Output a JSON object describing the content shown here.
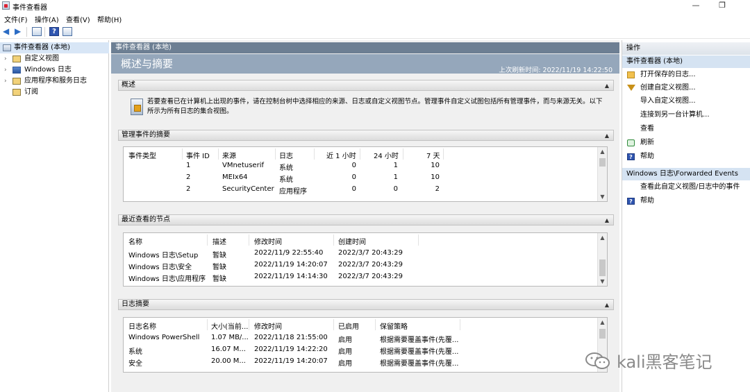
{
  "window": {
    "title": "事件查看器",
    "controls": {
      "minimize": "—",
      "restore": "❐",
      "close": "✕"
    }
  },
  "menu": [
    "文件(F)",
    "操作(A)",
    "查看(V)",
    "帮助(H)"
  ],
  "tree": {
    "root": "事件查看器 (本地)",
    "items": [
      "自定义视图",
      "Windows 日志",
      "应用程序和服务日志",
      "订阅"
    ]
  },
  "center": {
    "header": "事件查看器 (本地)",
    "banner_title": "概述与摘要",
    "last_refresh": "上次刷新时间: 2022/11/19 14:22:50",
    "overview": {
      "title": "概述",
      "text": "若要查看已在计算机上出现的事件，请在控制台树中选择相应的来源、日志或自定义视图节点。管理事件自定义试图包括所有管理事件，而与来源无关。以下所示为所有日志的集合视图。"
    },
    "admin_summary": {
      "title": "管理事件的摘要",
      "columns": [
        "事件类型",
        "事件 ID",
        "来源",
        "日志",
        "近 1 小时",
        "24 小时",
        "7 天"
      ],
      "rows": [
        [
          "",
          "1",
          "VMnetuserif",
          "系统",
          "0",
          "1",
          "10"
        ],
        [
          "",
          "2",
          "MEIx64",
          "系统",
          "0",
          "1",
          "10"
        ],
        [
          "",
          "2",
          "SecurityCenter",
          "应用程序",
          "0",
          "0",
          "2"
        ]
      ]
    },
    "recent_nodes": {
      "title": "最近查看的节点",
      "columns": [
        "名称",
        "描述",
        "修改时间",
        "创建时间"
      ],
      "rows": [
        [
          "Windows 日志\\Setup",
          "暂缺",
          "2022/11/9 22:55:40",
          "2022/3/7 20:43:29"
        ],
        [
          "Windows 日志\\安全",
          "暂缺",
          "2022/11/19 14:20:07",
          "2022/3/7 20:43:29"
        ],
        [
          "Windows 日志\\应用程序",
          "暂缺",
          "2022/11/19 14:14:30",
          "2022/3/7 20:43:29"
        ]
      ]
    },
    "log_summary": {
      "title": "日志摘要",
      "columns": [
        "日志名称",
        "大小(当前...",
        "修改时间",
        "已启用",
        "保留策略"
      ],
      "rows": [
        [
          "Windows PowerShell",
          "1.07 MB/...",
          "2022/11/18 21:55:00",
          "启用",
          "根据需要覆盖事件(先覆..."
        ],
        [
          "系统",
          "16.07 M...",
          "2022/11/19 14:22:20",
          "启用",
          "根据需要覆盖事件(先覆..."
        ],
        [
          "安全",
          "20.00 M...",
          "2022/11/19 14:20:07",
          "启用",
          "根据需要覆盖事件(先覆..."
        ]
      ]
    }
  },
  "actions": {
    "title": "操作",
    "group1_title": "事件查看器 (本地)",
    "group1": [
      {
        "icon": "folder-open-icon",
        "label": "打开保存的日志..."
      },
      {
        "icon": "filter-icon",
        "label": "创建自定义视图..."
      },
      {
        "icon": "",
        "label": "导入自定义视图..."
      },
      {
        "icon": "",
        "label": "连接到另一台计算机..."
      },
      {
        "icon": "",
        "label": "查看"
      },
      {
        "icon": "refresh-icon",
        "label": "刷新"
      },
      {
        "icon": "help-icon",
        "label": "帮助"
      }
    ],
    "group2_title": "Windows 日志\\Forwarded Events",
    "group2": [
      {
        "icon": "",
        "label": "查看此自定义视图/日志中的事件"
      },
      {
        "icon": "help-icon",
        "label": "帮助"
      }
    ]
  },
  "watermark": {
    "text": "kali黑客笔记"
  }
}
